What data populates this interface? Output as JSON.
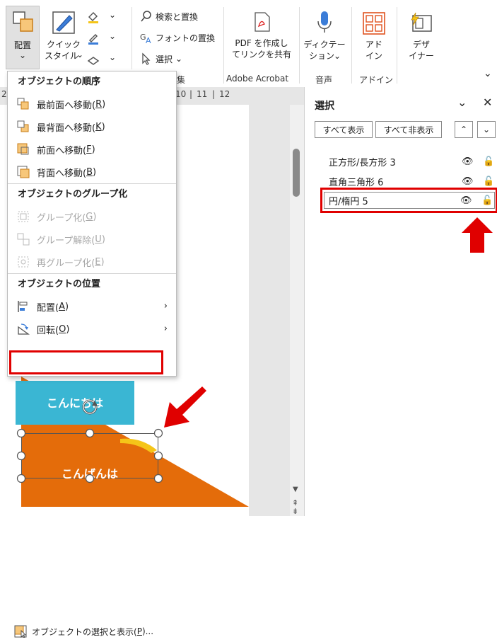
{
  "ribbon": {
    "arrange": {
      "label": "配置",
      "dropdown": "⌄"
    },
    "quick_style": {
      "label_line1": "クイック",
      "label_line2": "スタイル"
    },
    "edit": {
      "find_replace": "検索と置換",
      "font_replace": "フォントの置換",
      "select": "選択",
      "group_label": "集"
    },
    "adobe": {
      "label_line1": "PDF を作成し",
      "label_line2": "てリンクを共有",
      "group_label": "Adobe Acrobat"
    },
    "dictation": {
      "label_line1": "ディクテー",
      "label_line2": "ション",
      "group_label": "音声"
    },
    "addin": {
      "label_line1": "アド",
      "label_line2": "イン",
      "group_label": "アドイン"
    },
    "designer": {
      "label_line1": "デザ",
      "label_line2": "イナー"
    },
    "collapse": "⌄"
  },
  "ruler": {
    "ticks": [
      "10",
      "11",
      "12"
    ],
    "left_mark": "2"
  },
  "menu": {
    "order_header": "オブジェクトの順序",
    "order_items": [
      {
        "label": "最前面へ移動(",
        "key": "R",
        "suffix": ")"
      },
      {
        "label": "最背面へ移動(",
        "key": "K",
        "suffix": ")"
      },
      {
        "label": "前面へ移動(",
        "key": "F",
        "suffix": ")"
      },
      {
        "label": "背面へ移動(",
        "key": "B",
        "suffix": ")"
      }
    ],
    "group_header": "オブジェクトのグループ化",
    "group_items": [
      {
        "label": "グループ化(",
        "key": "G",
        "suffix": ")"
      },
      {
        "label": "グループ解除(",
        "key": "U",
        "suffix": ")"
      },
      {
        "label": "再グループ化(",
        "key": "E",
        "suffix": ")"
      }
    ],
    "position_header": "オブジェクトの位置",
    "position_items": [
      {
        "label": "配置(",
        "key": "A",
        "suffix": ")"
      },
      {
        "label": "回転(",
        "key": "O",
        "suffix": ")"
      }
    ],
    "selection_pane": {
      "label": "オブジェクトの選択と表示(",
      "key": "P",
      "suffix": ")..."
    }
  },
  "slide": {
    "shape_blue_text": "こんにちは",
    "shape_circle_text": "こんばんは",
    "colors": {
      "blue": "#3ab6d3",
      "orange": "#e46c0a",
      "yellow": "#f5c518"
    }
  },
  "pane": {
    "title": "選択",
    "show_all": "すべて表示",
    "hide_all": "すべて非表示",
    "items": [
      {
        "name": "正方形/長方形 3"
      },
      {
        "name": "直角三角形 6"
      },
      {
        "name": "円/楕円 5"
      }
    ]
  },
  "accent": {
    "red": "#e00000"
  }
}
